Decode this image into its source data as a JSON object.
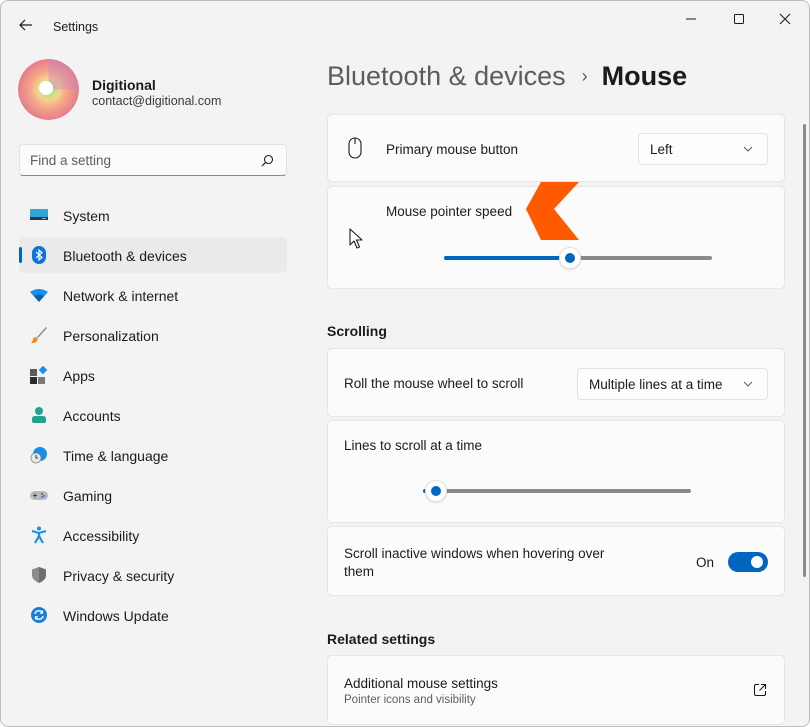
{
  "window": {
    "title": "Settings",
    "controls": {
      "minimize": "minimize-icon",
      "maximize": "maximize-icon",
      "close": "close-icon"
    }
  },
  "profile": {
    "name": "Digitional",
    "email": "contact@digitional.com"
  },
  "search": {
    "placeholder": "Find a setting",
    "value": ""
  },
  "sidebar": {
    "items": [
      {
        "label": "System",
        "icon": "system-icon",
        "active": false
      },
      {
        "label": "Bluetooth & devices",
        "icon": "bluetooth-icon",
        "active": true
      },
      {
        "label": "Network & internet",
        "icon": "wifi-icon",
        "active": false
      },
      {
        "label": "Personalization",
        "icon": "brush-icon",
        "active": false
      },
      {
        "label": "Apps",
        "icon": "apps-icon",
        "active": false
      },
      {
        "label": "Accounts",
        "icon": "person-icon",
        "active": false
      },
      {
        "label": "Time & language",
        "icon": "clock-globe-icon",
        "active": false
      },
      {
        "label": "Gaming",
        "icon": "gamepad-icon",
        "active": false
      },
      {
        "label": "Accessibility",
        "icon": "accessibility-icon",
        "active": false
      },
      {
        "label": "Privacy & security",
        "icon": "shield-icon",
        "active": false
      },
      {
        "label": "Windows Update",
        "icon": "update-icon",
        "active": false
      }
    ]
  },
  "header": {
    "parent": "Bluetooth & devices",
    "separator": "›",
    "current": "Mouse"
  },
  "settings": {
    "primary_button": {
      "label": "Primary mouse button",
      "value": "Left"
    },
    "pointer_speed": {
      "label": "Mouse pointer speed",
      "value_fraction": 0.47
    },
    "scrolling_section": "Scrolling",
    "wheel_scroll": {
      "label": "Roll the mouse wheel to scroll",
      "value": "Multiple lines at a time"
    },
    "lines_to_scroll": {
      "label": "Lines to scroll at a time",
      "value_fraction": 0.05
    },
    "inactive_scroll": {
      "label": "Scroll inactive windows when hovering over them",
      "state_label": "On",
      "on": true
    },
    "related_section": "Related settings",
    "additional_mouse": {
      "label": "Additional mouse settings",
      "sublabel": "Pointer icons and visibility"
    }
  },
  "colors": {
    "accent": "#0067c0",
    "annotation": "#ff5a00"
  }
}
